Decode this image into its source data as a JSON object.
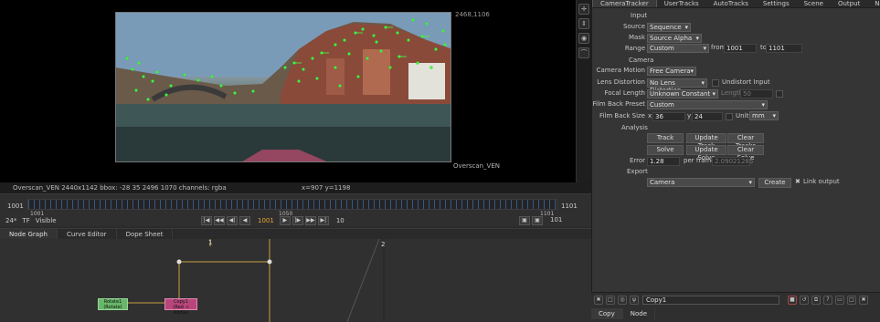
{
  "viewer": {
    "coord_top_right": "2468,1106",
    "format_label": "Overscan_VEN"
  },
  "viewer_tools": [
    "crosshair-icon",
    "move-icon",
    "target-icon",
    "lasso-icon"
  ],
  "infobar": {
    "info": "Overscan_VEN 2440x1142  bbox: -28 35 2496 1070 channels: rgba",
    "xy": "x=907 y=1198"
  },
  "timeline": {
    "start_frame": "1001",
    "end_frame": "1101",
    "mid_frame": "1050",
    "track_start": "1001",
    "track_end": "1101",
    "current_frame": "1001",
    "fps": "24*",
    "tf": "TF",
    "visible": "Visible",
    "step": "10",
    "end_display": "101"
  },
  "node_tabs": [
    "Node Graph",
    "Curve Editor",
    "Dope Sheet"
  ],
  "nodes": {
    "rotate": {
      "name": "Rotate1",
      "sub": "(Rotate)"
    },
    "copy": {
      "name": "Copy1",
      "sub": "(Red → Alpha)"
    },
    "marker1": "1",
    "marker2": "2"
  },
  "panel": {
    "tabs": [
      "CameraTracker",
      "UserTracks",
      "AutoTracks",
      "Settings",
      "Scene",
      "Output",
      "Node"
    ],
    "input_header": "Input",
    "source_label": "Source",
    "source_value": "Sequence",
    "mask_label": "Mask",
    "mask_value": "Source Alpha",
    "range_label": "Range",
    "range_value": "Custom",
    "from_label": "from",
    "from_value": "1001",
    "to_label": "to",
    "to_value": "1101",
    "camera_header": "Camera",
    "motion_label": "Camera Motion",
    "motion_value": "Free Camera",
    "lens_label": "Lens Distortion",
    "lens_value": "No Lens Distortion",
    "undistort_label": "Undistort Input",
    "focal_label": "Focal Length",
    "focal_value": "Unknown Constant",
    "length_label": "Length",
    "length_value": "50",
    "preset_label": "Film Back Preset",
    "preset_value": "Custom",
    "size_label": "Film Back Size",
    "x_label": "x",
    "x_value": "36",
    "y_label": "y",
    "y_value": "24",
    "units_label": "Units",
    "units_value": "mm",
    "analysis_header": "Analysis",
    "track_btn": "Track",
    "update_track_btn": "Update Track",
    "clear_tracks_btn": "Clear Tracks",
    "solve_btn": "Solve",
    "update_solve_btn": "Update Solve",
    "clear_solve_btn": "Clear Solve",
    "error_label": "Error",
    "error_value": "1.28",
    "per_frame_label": "per frame",
    "per_frame_value": "2.09021285",
    "export_header": "Export",
    "export_value": "Camera",
    "create_btn": "Create",
    "link_output_label": "Link output"
  },
  "bottom_panel": {
    "node_name": "Copy1",
    "tabs": [
      "Copy",
      "Node"
    ]
  }
}
